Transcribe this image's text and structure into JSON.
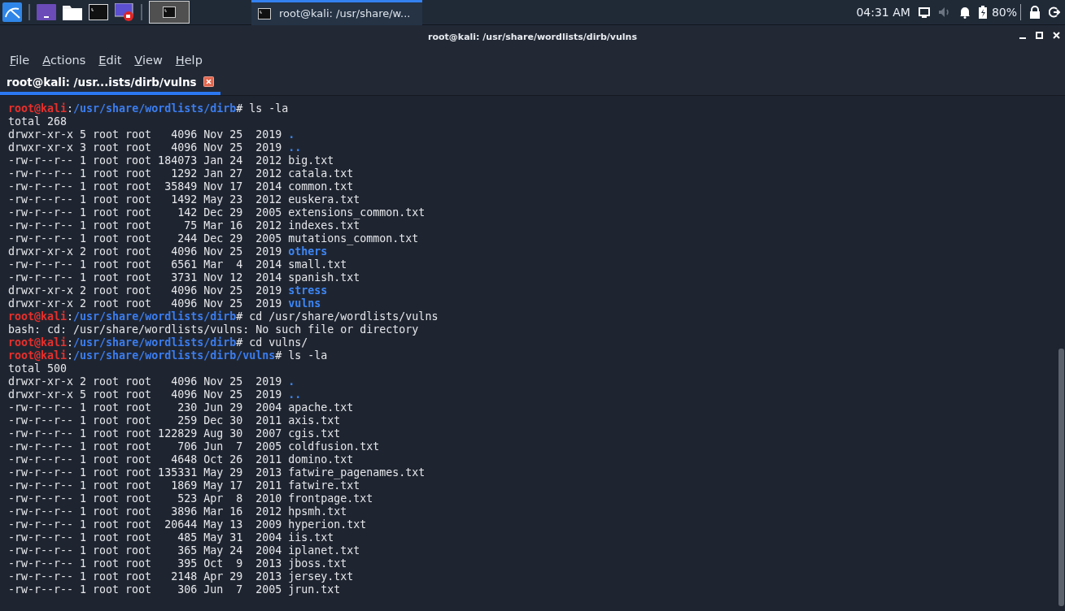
{
  "taskbar": {
    "workspaces": [
      {
        "selected": true
      }
    ],
    "tasks": [
      {
        "title": "root@kali: /usr/share/w...",
        "selected": true
      }
    ],
    "clock": "04:31 AM",
    "battery": "80%"
  },
  "window": {
    "title": "root@kali: /usr/share/wordlists/dirb/vulns"
  },
  "menu": [
    "File",
    "Actions",
    "Edit",
    "View",
    "Help"
  ],
  "tabs": [
    {
      "label": "root@kali: /usr...ists/dirb/vulns",
      "selected": true
    }
  ],
  "terminal": {
    "lines": [
      [
        {
          "text": "root@kali",
          "kind": "user"
        },
        {
          "text": ":",
          "kind": "plain"
        },
        {
          "text": "/usr/share/wordlists/dirb",
          "kind": "path"
        },
        {
          "text": "# ls -la",
          "kind": "plain"
        }
      ],
      [
        {
          "text": "total 268",
          "kind": "plain"
        }
      ],
      [
        {
          "text": "drwxr-xr-x 5 root root   4096 Nov 25  2019 ",
          "kind": "plain"
        },
        {
          "text": ".",
          "kind": "dir"
        }
      ],
      [
        {
          "text": "drwxr-xr-x 3 root root   4096 Nov 25  2019 ",
          "kind": "plain"
        },
        {
          "text": "..",
          "kind": "dir"
        }
      ],
      [
        {
          "text": "-rw-r--r-- 1 root root 184073 Jan 24  2012 big.txt",
          "kind": "plain"
        }
      ],
      [
        {
          "text": "-rw-r--r-- 1 root root   1292 Jan 27  2012 catala.txt",
          "kind": "plain"
        }
      ],
      [
        {
          "text": "-rw-r--r-- 1 root root  35849 Nov 17  2014 common.txt",
          "kind": "plain"
        }
      ],
      [
        {
          "text": "-rw-r--r-- 1 root root   1492 May 23  2012 euskera.txt",
          "kind": "plain"
        }
      ],
      [
        {
          "text": "-rw-r--r-- 1 root root    142 Dec 29  2005 extensions_common.txt",
          "kind": "plain"
        }
      ],
      [
        {
          "text": "-rw-r--r-- 1 root root     75 Mar 16  2012 indexes.txt",
          "kind": "plain"
        }
      ],
      [
        {
          "text": "-rw-r--r-- 1 root root    244 Dec 29  2005 mutations_common.txt",
          "kind": "plain"
        }
      ],
      [
        {
          "text": "drwxr-xr-x 2 root root   4096 Nov 25  2019 ",
          "kind": "plain"
        },
        {
          "text": "others",
          "kind": "dir"
        }
      ],
      [
        {
          "text": "-rw-r--r-- 1 root root   6561 Mar  4  2014 small.txt",
          "kind": "plain"
        }
      ],
      [
        {
          "text": "-rw-r--r-- 1 root root   3731 Nov 12  2014 spanish.txt",
          "kind": "plain"
        }
      ],
      [
        {
          "text": "drwxr-xr-x 2 root root   4096 Nov 25  2019 ",
          "kind": "plain"
        },
        {
          "text": "stress",
          "kind": "dir"
        }
      ],
      [
        {
          "text": "drwxr-xr-x 2 root root   4096 Nov 25  2019 ",
          "kind": "plain"
        },
        {
          "text": "vulns",
          "kind": "dir"
        }
      ],
      [
        {
          "text": "root@kali",
          "kind": "user"
        },
        {
          "text": ":",
          "kind": "plain"
        },
        {
          "text": "/usr/share/wordlists/dirb",
          "kind": "path"
        },
        {
          "text": "# cd /usr/share/wordlists/vulns",
          "kind": "plain"
        }
      ],
      [
        {
          "text": "bash: cd: /usr/share/wordlists/vulns: No such file or directory",
          "kind": "plain"
        }
      ],
      [
        {
          "text": "root@kali",
          "kind": "user"
        },
        {
          "text": ":",
          "kind": "plain"
        },
        {
          "text": "/usr/share/wordlists/dirb",
          "kind": "path"
        },
        {
          "text": "# cd vulns/",
          "kind": "plain"
        }
      ],
      [
        {
          "text": "root@kali",
          "kind": "user"
        },
        {
          "text": ":",
          "kind": "plain"
        },
        {
          "text": "/usr/share/wordlists/dirb/vulns",
          "kind": "path"
        },
        {
          "text": "# ls -la",
          "kind": "plain"
        }
      ],
      [
        {
          "text": "total 500",
          "kind": "plain"
        }
      ],
      [
        {
          "text": "drwxr-xr-x 2 root root   4096 Nov 25  2019 ",
          "kind": "plain"
        },
        {
          "text": ".",
          "kind": "dir"
        }
      ],
      [
        {
          "text": "drwxr-xr-x 5 root root   4096 Nov 25  2019 ",
          "kind": "plain"
        },
        {
          "text": "..",
          "kind": "dir"
        }
      ],
      [
        {
          "text": "-rw-r--r-- 1 root root    230 Jun 29  2004 apache.txt",
          "kind": "plain"
        }
      ],
      [
        {
          "text": "-rw-r--r-- 1 root root    259 Dec 30  2011 axis.txt",
          "kind": "plain"
        }
      ],
      [
        {
          "text": "-rw-r--r-- 1 root root 122829 Aug 30  2007 cgis.txt",
          "kind": "plain"
        }
      ],
      [
        {
          "text": "-rw-r--r-- 1 root root    706 Jun  7  2005 coldfusion.txt",
          "kind": "plain"
        }
      ],
      [
        {
          "text": "-rw-r--r-- 1 root root   4648 Oct 26  2011 domino.txt",
          "kind": "plain"
        }
      ],
      [
        {
          "text": "-rw-r--r-- 1 root root 135331 May 29  2013 fatwire_pagenames.txt",
          "kind": "plain"
        }
      ],
      [
        {
          "text": "-rw-r--r-- 1 root root   1869 May 17  2011 fatwire.txt",
          "kind": "plain"
        }
      ],
      [
        {
          "text": "-rw-r--r-- 1 root root    523 Apr  8  2010 frontpage.txt",
          "kind": "plain"
        }
      ],
      [
        {
          "text": "-rw-r--r-- 1 root root   3896 Mar 16  2012 hpsmh.txt",
          "kind": "plain"
        }
      ],
      [
        {
          "text": "-rw-r--r-- 1 root root  20644 May 13  2009 hyperion.txt",
          "kind": "plain"
        }
      ],
      [
        {
          "text": "-rw-r--r-- 1 root root    485 May 31  2004 iis.txt",
          "kind": "plain"
        }
      ],
      [
        {
          "text": "-rw-r--r-- 1 root root    365 May 24  2004 iplanet.txt",
          "kind": "plain"
        }
      ],
      [
        {
          "text": "-rw-r--r-- 1 root root    395 Oct  9  2013 jboss.txt",
          "kind": "plain"
        }
      ],
      [
        {
          "text": "-rw-r--r-- 1 root root   2148 Apr 29  2013 jersey.txt",
          "kind": "plain"
        }
      ],
      [
        {
          "text": "-rw-r--r-- 1 root root    306 Jun  7  2005 jrun.txt",
          "kind": "plain"
        }
      ]
    ]
  }
}
